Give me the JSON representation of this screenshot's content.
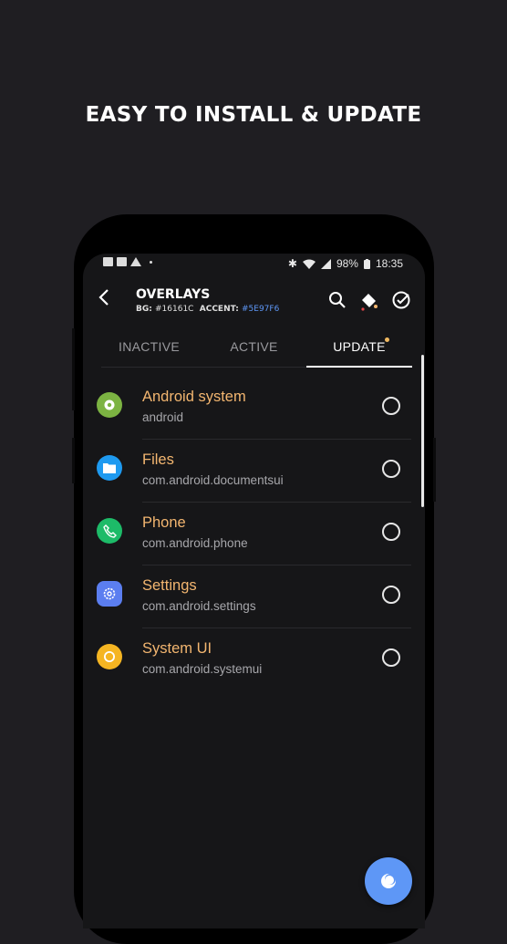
{
  "headline": "EASY TO INSTALL & UPDATE",
  "status_bar": {
    "battery": "98%",
    "time": "18:35"
  },
  "toolbar": {
    "title": "OVERLAYS",
    "bg_label": "BG:",
    "bg_value": "#16161C",
    "accent_label": "ACCENT:",
    "accent_value": "#5E97F6"
  },
  "tabs": [
    {
      "label": "INACTIVE",
      "selected": false
    },
    {
      "label": "ACTIVE",
      "selected": false
    },
    {
      "label": "UPDATE",
      "selected": true
    }
  ],
  "overlays": [
    {
      "name": "Android system",
      "package": "android",
      "icon": "android-system-gear-icon",
      "color": "#7cb342"
    },
    {
      "name": "Files",
      "package": "com.android.documentsui",
      "icon": "files-folder-icon",
      "color": "#1e9af0"
    },
    {
      "name": "Phone",
      "package": "com.android.phone",
      "icon": "phone-handset-icon",
      "color": "#1dbb68"
    },
    {
      "name": "Settings",
      "package": "com.android.settings",
      "icon": "settings-gear-icon",
      "color": "#5b7ef0"
    },
    {
      "name": "System UI",
      "package": "com.android.systemui",
      "icon": "system-ui-circle-icon",
      "color": "#f5b522"
    }
  ],
  "colors": {
    "accent": "#5E97F6",
    "background": "#16161C",
    "title_orange": "#F3B670",
    "update_badge": "#F0B860"
  }
}
